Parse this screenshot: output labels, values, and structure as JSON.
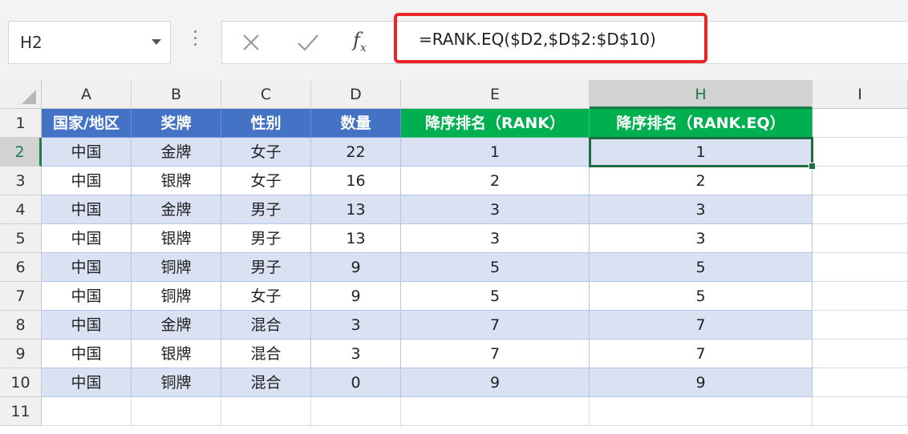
{
  "name_box": {
    "value": "H2"
  },
  "formula_bar": {
    "formula": "=RANK.EQ($D2,$D$2:$D$10)",
    "fx_label": "fx",
    "highlight_color": "#e8262a"
  },
  "columns": [
    "A",
    "B",
    "C",
    "D",
    "E",
    "H",
    "I"
  ],
  "rows": [
    "1",
    "2",
    "3",
    "4",
    "5",
    "6",
    "7",
    "8",
    "9",
    "10",
    "11"
  ],
  "selected_column": "H",
  "selected_row": "2",
  "header_row": [
    "国家/地区",
    "奖牌",
    "性别",
    "数量",
    "降序排名（RANK）",
    "降序排名（RANK.EQ）"
  ],
  "data_rows": [
    [
      "中国",
      "金牌",
      "女子",
      "22",
      "1",
      "1"
    ],
    [
      "中国",
      "银牌",
      "女子",
      "16",
      "2",
      "2"
    ],
    [
      "中国",
      "金牌",
      "男子",
      "13",
      "3",
      "3"
    ],
    [
      "中国",
      "银牌",
      "男子",
      "13",
      "3",
      "3"
    ],
    [
      "中国",
      "铜牌",
      "男子",
      "9",
      "5",
      "5"
    ],
    [
      "中国",
      "铜牌",
      "女子",
      "9",
      "5",
      "5"
    ],
    [
      "中国",
      "金牌",
      "混合",
      "3",
      "7",
      "7"
    ],
    [
      "中国",
      "银牌",
      "混合",
      "3",
      "7",
      "7"
    ],
    [
      "中国",
      "铜牌",
      "混合",
      "0",
      "9",
      "9"
    ]
  ],
  "colors": {
    "header_blue": "#4472c4",
    "header_green": "#00b050",
    "band_blue": "#d9e1f2",
    "selection_green": "#1f6e43"
  }
}
